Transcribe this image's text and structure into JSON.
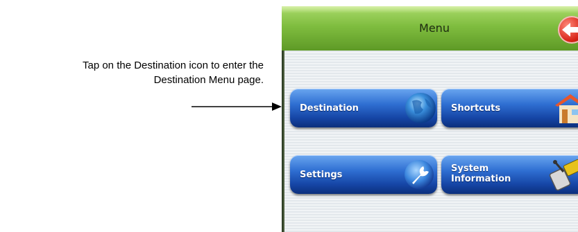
{
  "instruction": {
    "line1": "Tap on the Destination icon to enter the",
    "line2": "Destination Menu page."
  },
  "screen": {
    "title": "Menu",
    "back_icon": "back-arrow-icon",
    "accent_colors": {
      "title_bar": "#7fbd3f",
      "tile_blue": "#2f6fd2",
      "back_red": "#d82418"
    },
    "tiles": [
      {
        "label": "Destination",
        "icon": "globe-icon"
      },
      {
        "label": "Shortcuts",
        "icon": "house-icon"
      },
      {
        "label": "Settings",
        "icon": "wrench-icon"
      },
      {
        "label_line1": "System",
        "label_line2": "Information",
        "icon": "satellite-icon"
      }
    ]
  }
}
